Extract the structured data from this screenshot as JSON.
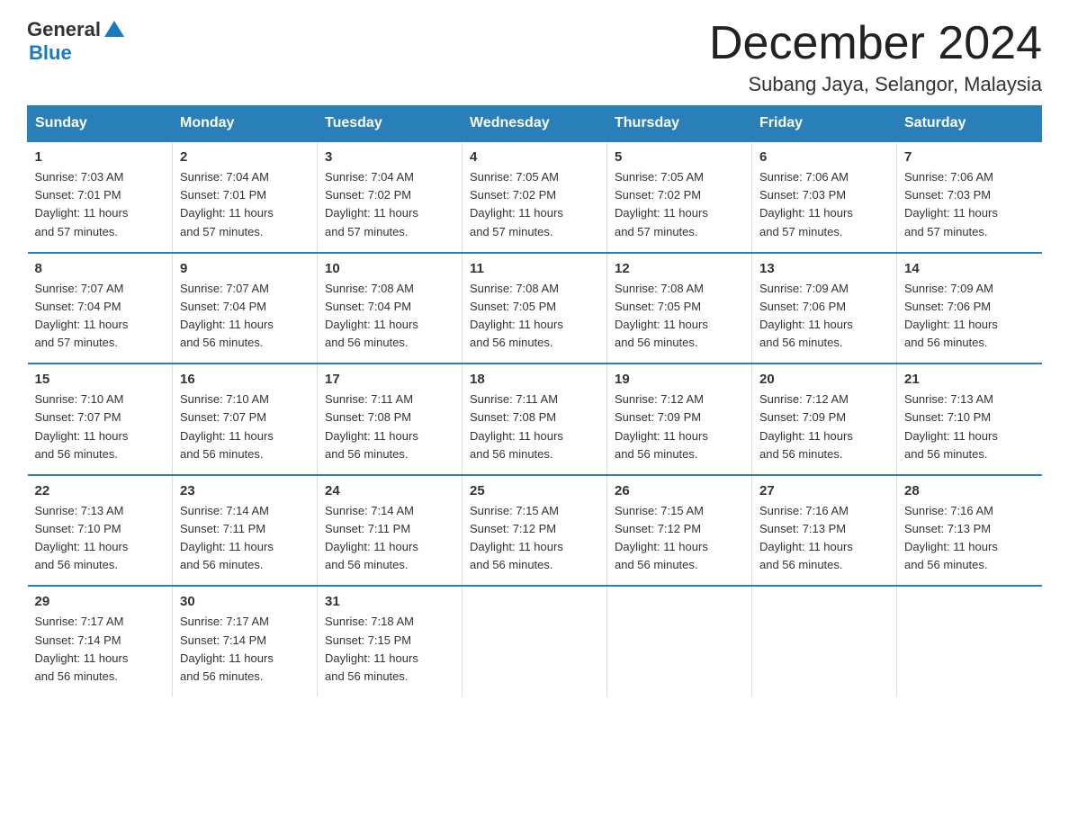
{
  "logo": {
    "general": "General",
    "blue": "Blue"
  },
  "title": "December 2024",
  "location": "Subang Jaya, Selangor, Malaysia",
  "header": {
    "days": [
      "Sunday",
      "Monday",
      "Tuesday",
      "Wednesday",
      "Thursday",
      "Friday",
      "Saturday"
    ]
  },
  "weeks": [
    [
      {
        "day": 1,
        "sunrise": "7:03 AM",
        "sunset": "7:01 PM",
        "daylight": "11 hours and 57 minutes."
      },
      {
        "day": 2,
        "sunrise": "7:04 AM",
        "sunset": "7:01 PM",
        "daylight": "11 hours and 57 minutes."
      },
      {
        "day": 3,
        "sunrise": "7:04 AM",
        "sunset": "7:02 PM",
        "daylight": "11 hours and 57 minutes."
      },
      {
        "day": 4,
        "sunrise": "7:05 AM",
        "sunset": "7:02 PM",
        "daylight": "11 hours and 57 minutes."
      },
      {
        "day": 5,
        "sunrise": "7:05 AM",
        "sunset": "7:02 PM",
        "daylight": "11 hours and 57 minutes."
      },
      {
        "day": 6,
        "sunrise": "7:06 AM",
        "sunset": "7:03 PM",
        "daylight": "11 hours and 57 minutes."
      },
      {
        "day": 7,
        "sunrise": "7:06 AM",
        "sunset": "7:03 PM",
        "daylight": "11 hours and 57 minutes."
      }
    ],
    [
      {
        "day": 8,
        "sunrise": "7:07 AM",
        "sunset": "7:04 PM",
        "daylight": "11 hours and 57 minutes."
      },
      {
        "day": 9,
        "sunrise": "7:07 AM",
        "sunset": "7:04 PM",
        "daylight": "11 hours and 56 minutes."
      },
      {
        "day": 10,
        "sunrise": "7:08 AM",
        "sunset": "7:04 PM",
        "daylight": "11 hours and 56 minutes."
      },
      {
        "day": 11,
        "sunrise": "7:08 AM",
        "sunset": "7:05 PM",
        "daylight": "11 hours and 56 minutes."
      },
      {
        "day": 12,
        "sunrise": "7:08 AM",
        "sunset": "7:05 PM",
        "daylight": "11 hours and 56 minutes."
      },
      {
        "day": 13,
        "sunrise": "7:09 AM",
        "sunset": "7:06 PM",
        "daylight": "11 hours and 56 minutes."
      },
      {
        "day": 14,
        "sunrise": "7:09 AM",
        "sunset": "7:06 PM",
        "daylight": "11 hours and 56 minutes."
      }
    ],
    [
      {
        "day": 15,
        "sunrise": "7:10 AM",
        "sunset": "7:07 PM",
        "daylight": "11 hours and 56 minutes."
      },
      {
        "day": 16,
        "sunrise": "7:10 AM",
        "sunset": "7:07 PM",
        "daylight": "11 hours and 56 minutes."
      },
      {
        "day": 17,
        "sunrise": "7:11 AM",
        "sunset": "7:08 PM",
        "daylight": "11 hours and 56 minutes."
      },
      {
        "day": 18,
        "sunrise": "7:11 AM",
        "sunset": "7:08 PM",
        "daylight": "11 hours and 56 minutes."
      },
      {
        "day": 19,
        "sunrise": "7:12 AM",
        "sunset": "7:09 PM",
        "daylight": "11 hours and 56 minutes."
      },
      {
        "day": 20,
        "sunrise": "7:12 AM",
        "sunset": "7:09 PM",
        "daylight": "11 hours and 56 minutes."
      },
      {
        "day": 21,
        "sunrise": "7:13 AM",
        "sunset": "7:10 PM",
        "daylight": "11 hours and 56 minutes."
      }
    ],
    [
      {
        "day": 22,
        "sunrise": "7:13 AM",
        "sunset": "7:10 PM",
        "daylight": "11 hours and 56 minutes."
      },
      {
        "day": 23,
        "sunrise": "7:14 AM",
        "sunset": "7:11 PM",
        "daylight": "11 hours and 56 minutes."
      },
      {
        "day": 24,
        "sunrise": "7:14 AM",
        "sunset": "7:11 PM",
        "daylight": "11 hours and 56 minutes."
      },
      {
        "day": 25,
        "sunrise": "7:15 AM",
        "sunset": "7:12 PM",
        "daylight": "11 hours and 56 minutes."
      },
      {
        "day": 26,
        "sunrise": "7:15 AM",
        "sunset": "7:12 PM",
        "daylight": "11 hours and 56 minutes."
      },
      {
        "day": 27,
        "sunrise": "7:16 AM",
        "sunset": "7:13 PM",
        "daylight": "11 hours and 56 minutes."
      },
      {
        "day": 28,
        "sunrise": "7:16 AM",
        "sunset": "7:13 PM",
        "daylight": "11 hours and 56 minutes."
      }
    ],
    [
      {
        "day": 29,
        "sunrise": "7:17 AM",
        "sunset": "7:14 PM",
        "daylight": "11 hours and 56 minutes."
      },
      {
        "day": 30,
        "sunrise": "7:17 AM",
        "sunset": "7:14 PM",
        "daylight": "11 hours and 56 minutes."
      },
      {
        "day": 31,
        "sunrise": "7:18 AM",
        "sunset": "7:15 PM",
        "daylight": "11 hours and 56 minutes."
      },
      null,
      null,
      null,
      null
    ]
  ],
  "labels": {
    "sunrise": "Sunrise:",
    "sunset": "Sunset:",
    "daylight": "Daylight:"
  }
}
